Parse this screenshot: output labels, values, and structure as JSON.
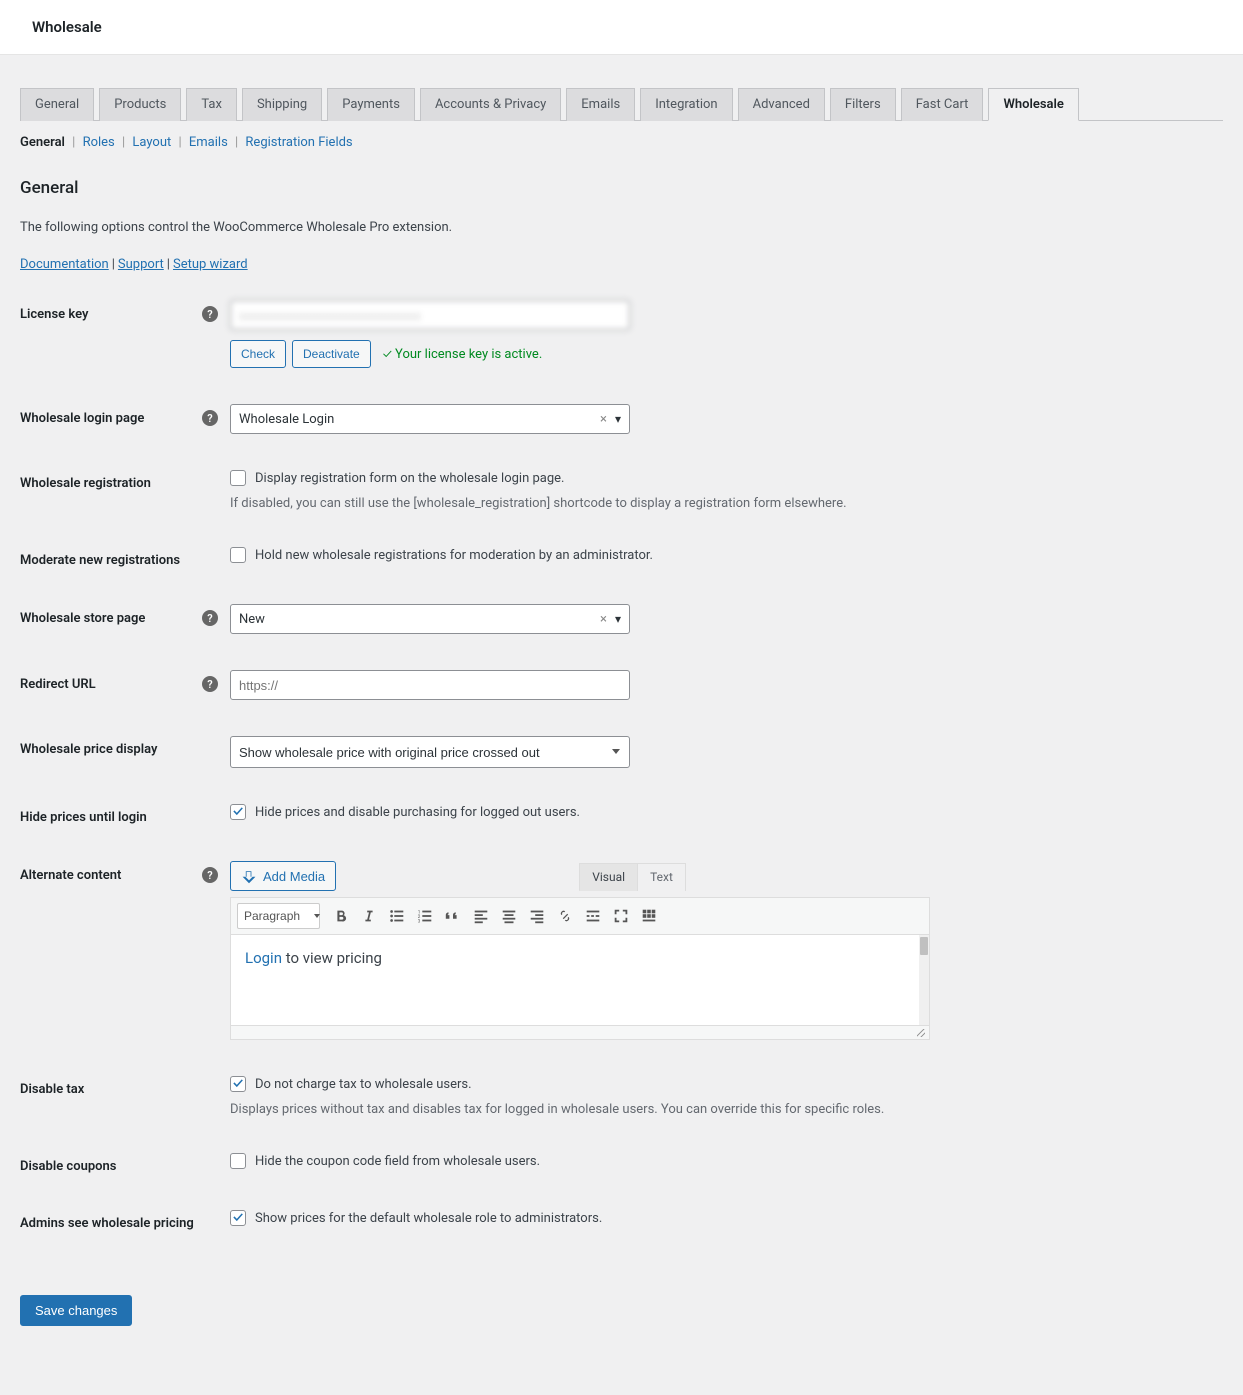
{
  "header": {
    "title": "Wholesale"
  },
  "tabs": {
    "items": [
      "General",
      "Products",
      "Tax",
      "Shipping",
      "Payments",
      "Accounts & Privacy",
      "Emails",
      "Integration",
      "Advanced",
      "Filters",
      "Fast Cart",
      "Wholesale"
    ],
    "active_index": 11
  },
  "subtabs": {
    "items": [
      "General",
      "Roles",
      "Layout",
      "Emails",
      "Registration Fields"
    ],
    "active_index": 0
  },
  "section": {
    "title": "General",
    "desc": "The following options control the WooCommerce Wholesale Pro extension."
  },
  "doc_links": {
    "documentation": "Documentation",
    "support": "Support",
    "setup": "Setup wizard"
  },
  "license": {
    "label": "License key",
    "value": "",
    "check": "Check",
    "deactivate": "Deactivate",
    "status": "✓ Your license key is active."
  },
  "login_page": {
    "label": "Wholesale login page",
    "value": "Wholesale Login"
  },
  "registration": {
    "label": "Wholesale registration",
    "check_label": "Display registration form on the wholesale login page.",
    "checked": false,
    "help": "If disabled, you can still use the [wholesale_registration] shortcode to display a registration form elsewhere."
  },
  "moderate": {
    "label": "Moderate new registrations",
    "check_label": "Hold new wholesale registrations for moderation by an administrator.",
    "checked": false
  },
  "store_page": {
    "label": "Wholesale store page",
    "value": "New"
  },
  "redirect": {
    "label": "Redirect URL",
    "placeholder": "https://"
  },
  "price_display": {
    "label": "Wholesale price display",
    "value": "Show wholesale price with original price crossed out"
  },
  "hide_prices": {
    "label": "Hide prices until login",
    "check_label": "Hide prices and disable purchasing for logged out users.",
    "checked": true
  },
  "alt_content": {
    "label": "Alternate content",
    "add_media": "Add Media",
    "tabs": {
      "visual": "Visual",
      "text": "Text"
    },
    "format": "Paragraph",
    "body_link": "Login",
    "body_rest": " to view pricing"
  },
  "disable_tax": {
    "label": "Disable tax",
    "check_label": "Do not charge tax to wholesale users.",
    "checked": true,
    "help": "Displays prices without tax and disables tax for logged in wholesale users. You can override this for specific roles."
  },
  "disable_coupons": {
    "label": "Disable coupons",
    "check_label": "Hide the coupon code field from wholesale users.",
    "checked": false
  },
  "admins_see": {
    "label": "Admins see wholesale pricing",
    "check_label": "Show prices for the default wholesale role to administrators.",
    "checked": true
  },
  "save": {
    "label": "Save changes"
  }
}
